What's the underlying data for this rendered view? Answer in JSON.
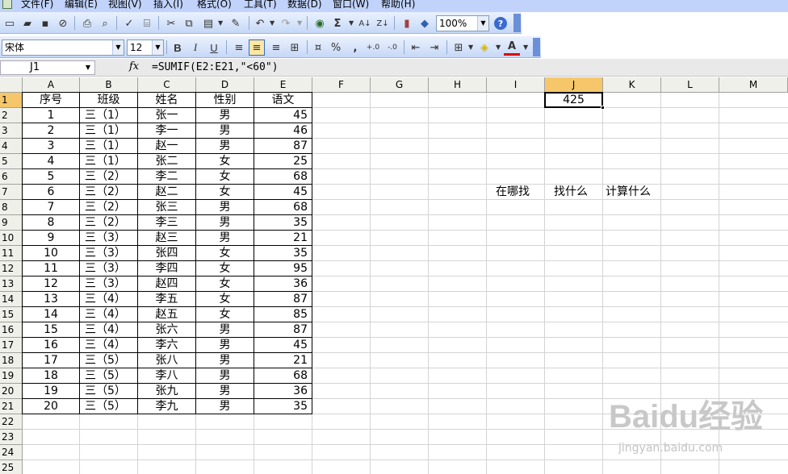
{
  "menu": [
    "文件(F)",
    "编辑(E)",
    "视图(V)",
    "插入(I)",
    "格式(O)",
    "工具(T)",
    "数据(D)",
    "窗口(W)",
    "帮助(H)"
  ],
  "toolbar1": {
    "zoom": "100%",
    "icons": [
      "new-icon",
      "open-icon",
      "save-icon",
      "permission-icon",
      "print-icon",
      "print-preview-icon",
      "spelling-icon",
      "research-icon",
      "cut-icon",
      "copy-icon",
      "paste-icon",
      "format-painter-icon",
      "undo-icon",
      "redo-icon",
      "hyperlink-icon",
      "autosum-icon",
      "sort-ascending-icon",
      "sort-descending-icon",
      "chart-wizard-icon",
      "drawing-icon",
      "help-icon"
    ],
    "glyphs": {
      "autosum": "Σ",
      "sort_asc": "A↓",
      "sort_desc": "Z↓",
      "help": "?"
    }
  },
  "toolbar2": {
    "font_name": "宋体",
    "font_size": "12",
    "bold": "B",
    "italic": "I",
    "underline": "U",
    "percent": "%",
    "comma": ",",
    "inc_decimal": "+.0",
    "dec_decimal": "-.0",
    "font_color_letter": "A",
    "active_alignment": "center"
  },
  "formula_bar": {
    "name_box": "J1",
    "fx_label": "fx",
    "formula": "=SUMIF(E2:E21,\"<60\")"
  },
  "grid": {
    "columns": [
      "A",
      "B",
      "C",
      "D",
      "E",
      "F",
      "G",
      "H",
      "I",
      "J",
      "K",
      "L",
      "M"
    ],
    "active_column": "J",
    "active_row": 1,
    "rows": [
      "1",
      "2",
      "3",
      "4",
      "5",
      "6",
      "7",
      "8",
      "9",
      "10",
      "11",
      "12",
      "13",
      "14",
      "15",
      "16",
      "17",
      "18",
      "19",
      "20",
      "21",
      "22",
      "23",
      "24",
      "25"
    ],
    "headers": [
      "序号",
      "班级",
      "姓名",
      "性别",
      "语文"
    ],
    "data": [
      [
        "1",
        "三（1）",
        "张一",
        "男",
        "45"
      ],
      [
        "2",
        "三（1）",
        "李一",
        "男",
        "46"
      ],
      [
        "3",
        "三（1）",
        "赵一",
        "男",
        "87"
      ],
      [
        "4",
        "三（1）",
        "张二",
        "女",
        "25"
      ],
      [
        "5",
        "三（2）",
        "李二",
        "女",
        "68"
      ],
      [
        "6",
        "三（2）",
        "赵二",
        "女",
        "45"
      ],
      [
        "7",
        "三（2）",
        "张三",
        "男",
        "68"
      ],
      [
        "8",
        "三（2）",
        "李三",
        "男",
        "35"
      ],
      [
        "9",
        "三（3）",
        "赵三",
        "男",
        "21"
      ],
      [
        "10",
        "三（3）",
        "张四",
        "女",
        "35"
      ],
      [
        "11",
        "三（3）",
        "李四",
        "女",
        "95"
      ],
      [
        "12",
        "三（3）",
        "赵四",
        "女",
        "36"
      ],
      [
        "13",
        "三（4）",
        "李五",
        "女",
        "87"
      ],
      [
        "14",
        "三（4）",
        "赵五",
        "女",
        "85"
      ],
      [
        "15",
        "三（4）",
        "张六",
        "男",
        "87"
      ],
      [
        "16",
        "三（4）",
        "李六",
        "男",
        "45"
      ],
      [
        "17",
        "三（5）",
        "张八",
        "男",
        "21"
      ],
      [
        "18",
        "三（5）",
        "李八",
        "男",
        "68"
      ],
      [
        "19",
        "三（5）",
        "张九",
        "男",
        "36"
      ],
      [
        "20",
        "三（5）",
        "李九",
        "男",
        "35"
      ]
    ],
    "j1_value": "425",
    "notes": {
      "I7": "在哪找",
      "J7": "找什么",
      "K7": "计算什么"
    }
  },
  "watermark": {
    "logo": "Baidu经验",
    "sub": "jingyan.baidu.com"
  }
}
